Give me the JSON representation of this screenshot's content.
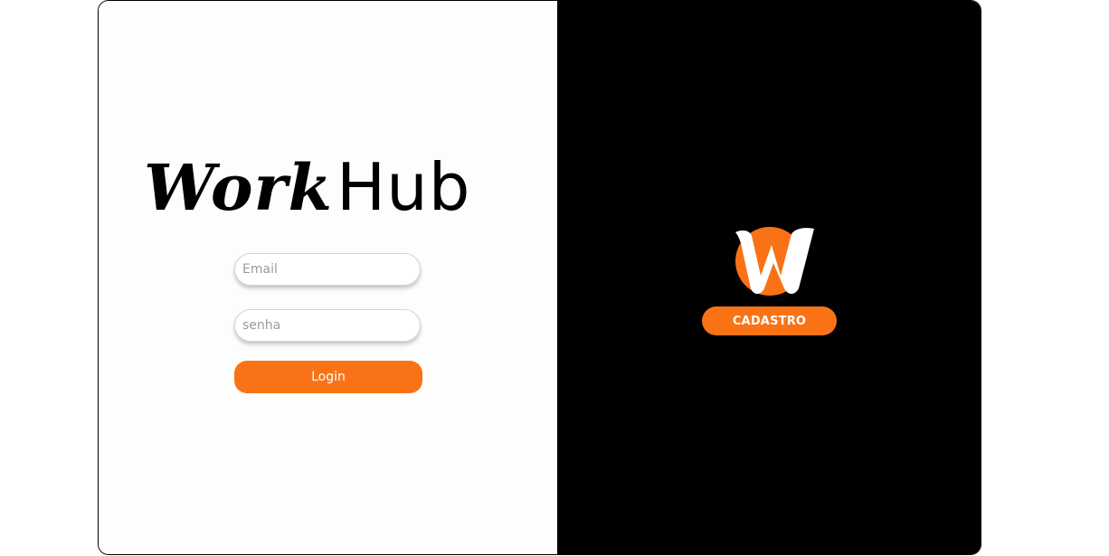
{
  "brand": {
    "part1": "Work",
    "part2": "Hub"
  },
  "login_form": {
    "email_placeholder": "Email",
    "password_placeholder": "senha",
    "login_label": "Login"
  },
  "register_panel": {
    "logo_icon": "workhub-w-logo-icon",
    "cadastro_label": "CADASTRO"
  },
  "colors": {
    "accent": "#f97316",
    "left_panel": "#fdfdfd",
    "right_panel": "#000000"
  }
}
